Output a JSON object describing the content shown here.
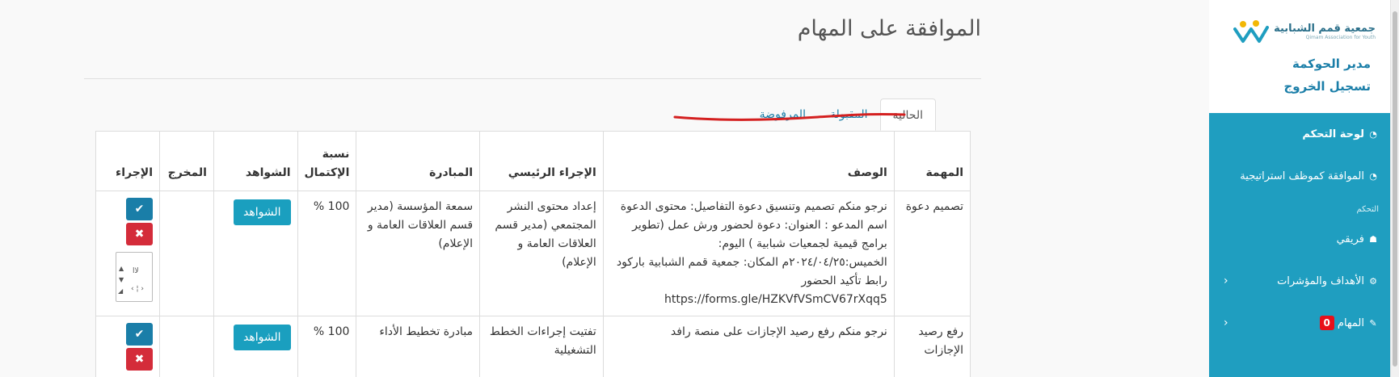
{
  "sidebar": {
    "logo": {
      "name_ar": "جمعية قمم الشبابية",
      "name_en": "Qimam Association for Youth"
    },
    "role": "مدير الحوكمة",
    "logout": "تسجيل الخروج",
    "nav": {
      "dashboard": "لوحة التحكم",
      "approval_strategy": "الموافقة كموظف استراتيجية",
      "section_label": "التحكم",
      "team": "فريقي",
      "goals": "الأهداف والمؤشرات",
      "tasks": "المهام",
      "tasks_badge": "0"
    }
  },
  "page": {
    "title": "الموافقة على المهام",
    "tabs": [
      "الحالية",
      "المقبولة",
      "المرفوضة"
    ],
    "active_tab": "الحالية"
  },
  "table": {
    "headers": {
      "task": "المهمة",
      "desc": "الوصف",
      "procedure": "الإجراء الرئيسي",
      "initiative": "المبادرة",
      "progress": "نسبة الإكتمال",
      "evidence": "الشواهد",
      "output": "المخرج",
      "action": "الإجراء"
    },
    "rows": [
      {
        "task": "تصميم دعوة",
        "desc": "نرجو منكم تصميم وتنسيق دعوة التفاصيل: محتوى الدعوة اسم المدعو : العنوان: دعوة لحضور ورش عمل (تطوير برامج قيمية لجمعيات شبابية ) اليوم: الخميس:٢٠٢٤/٠٤/٢٥م المكان: جمعية قمم الشبابية باركود رابط تأكيد الحضور https://forms.gle/HZKVfVSmCV67rXqq5",
        "procedure": "إعداد محتوى النشر المجتمعي (مدير قسم العلاقات العامة و الإعلام)",
        "initiative": "سمعة المؤسسة (مدير قسم العلاقات العامة و الإعلام)",
        "progress": "100 %",
        "evidence_label": "الشواهد",
        "output": "",
        "note_text": "لاا"
      },
      {
        "task": "رفع رصيد الإجازات",
        "desc": "نرجو منكم رفع رصيد الإجازات على منصة رافد",
        "procedure": "تفتيت إجراءات الخطط التشغيلية",
        "initiative": "مبادرة تخطيط الأداء",
        "progress": "100 %",
        "evidence_label": "الشواهد",
        "output": ""
      }
    ]
  },
  "colors": {
    "sidebar_nav_bg": "#1f9ec0",
    "link": "#1a7ea8",
    "approve": "#1a7ea8",
    "reject": "#d42c3a",
    "evidence_btn": "#1a9fbf",
    "badge": "#e8101a",
    "annotation": "#d42020"
  },
  "icons": {
    "dashboard": "gauge-icon",
    "approval": "gauge-icon",
    "team": "users-icon",
    "goals": "gear-icon",
    "tasks": "wrench-icon",
    "approve": "check-icon",
    "reject": "times-icon",
    "collapse": "chevron-left-icon"
  }
}
